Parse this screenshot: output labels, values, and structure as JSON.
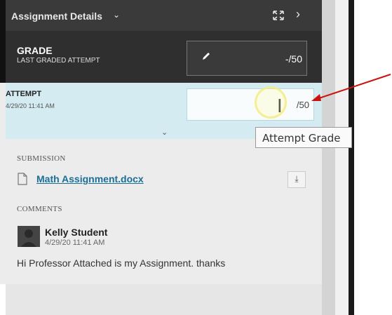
{
  "header": {
    "title": "Assignment Details",
    "title_chevron": "⌄",
    "next_glyph": "›"
  },
  "grade": {
    "title": "GRADE",
    "subtitle": "LAST GRADED ATTEMPT",
    "value": "-/50"
  },
  "attempt": {
    "title": "ATTEMPT",
    "date": "4/29/20 11:41 AM",
    "suffix": "/50",
    "cursor_glyph": "I",
    "expand_glyph": "⌄"
  },
  "tooltip": {
    "text": "Attempt Grade"
  },
  "submission": {
    "label": "SUBMISSION",
    "file_name": "Math Assignment.docx",
    "download_glyph": "⤓"
  },
  "comments": {
    "label": "COMMENTS",
    "author": "Kelly Student",
    "date": "4/29/20 11:41 AM",
    "text": "Hi Professor Attached is my Assignment.  thanks"
  },
  "colors": {
    "header_bg": "#3a3a3a",
    "attempt_bg": "#d4ebf2",
    "link": "#1b6f97",
    "arrow": "#cc1111",
    "highlight": "#f5eb82"
  },
  "icons": [
    "expand-icon",
    "chevron-right-icon",
    "pencil-icon",
    "document-icon",
    "download-icon",
    "avatar",
    "text-cursor-icon",
    "annotation-arrow"
  ]
}
